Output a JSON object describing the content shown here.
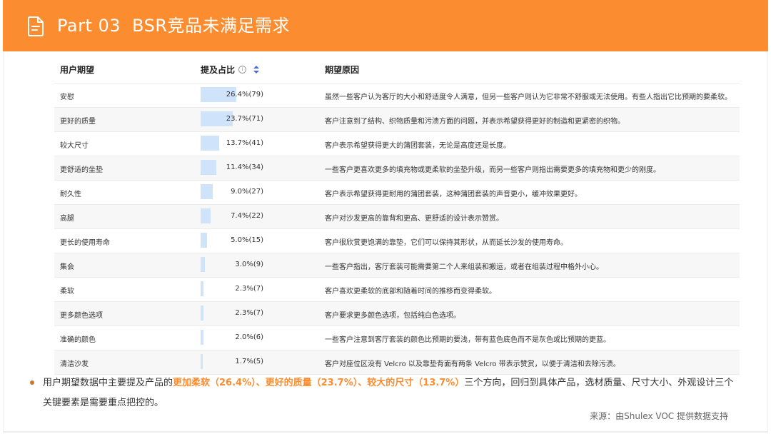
{
  "header": {
    "part": "Part 03",
    "title": "BSR竞品未满足需求",
    "background_color": "#fb8c2f",
    "icon": "document-icon"
  },
  "table": {
    "columns": {
      "need": "用户期望",
      "pct": "提及占比",
      "reason": "期望原因"
    },
    "rows": [
      {
        "need": "安慰",
        "pct_label": "26.4%(79)",
        "pct": 26.4,
        "reason": "虽然一些客户认为客厅的大小和舒适度令人满意，但另一些客户则认为它非常不舒服或无法使用。有些人指出它比预期的要柔软。"
      },
      {
        "need": "更好的质量",
        "pct_label": "23.7%(71)",
        "pct": 23.7,
        "reason": "客户注意到了结构、织物质量和污渍方面的问题，并表示希望获得更好的制造和更紧密的织物。"
      },
      {
        "need": "较大尺寸",
        "pct_label": "13.7%(41)",
        "pct": 13.7,
        "reason": "客户表示希望获得更大的蒲团套装，无论是高度还是长度。"
      },
      {
        "need": "更舒适的坐垫",
        "pct_label": "11.4%(34)",
        "pct": 11.4,
        "reason": "一些客户更喜欢更多的填充物或更柔软的坐垫升级，而另一些客户则指出需要更多的填充物和更少的刚度。"
      },
      {
        "need": "耐久性",
        "pct_label": "9.0%(27)",
        "pct": 9.0,
        "reason": "客户表示希望获得更耐用的蒲团套装，这种蒲团套装的声音更小，缓冲效果更好。"
      },
      {
        "need": "高腿",
        "pct_label": "7.4%(22)",
        "pct": 7.4,
        "reason": "客户对沙发更高的靠背和更高、更舒适的设计表示赞赏。"
      },
      {
        "need": "更长的使用寿命",
        "pct_label": "5.0%(15)",
        "pct": 5.0,
        "reason": "客户很欣赏更饱满的靠垫，它们可以保持其形状，从而延长沙发的使用寿命。"
      },
      {
        "need": "集会",
        "pct_label": "3.0%(9)",
        "pct": 3.0,
        "reason": "一些客户指出，客厅套装可能需要第二个人来组装和搬运，或者在组装过程中格外小心。"
      },
      {
        "need": "柔软",
        "pct_label": "2.3%(7)",
        "pct": 2.3,
        "reason": "客户喜欢更柔软的底部和随着时间的推移而变得柔软。"
      },
      {
        "need": "更多颜色选项",
        "pct_label": "2.3%(7)",
        "pct": 2.3,
        "reason": "客户要求更多颜色选项，包括纯白色选项。"
      },
      {
        "need": "准确的颜色",
        "pct_label": "2.0%(6)",
        "pct": 2.0,
        "reason": "一些客户注意到客厅套装的颜色比预期的要浅，带有蓝色底色而不是灰色或比预期的更蓝。"
      },
      {
        "need": "清洁沙发",
        "pct_label": "1.7%(5)",
        "pct": 1.7,
        "reason": "客户对座位区没有 Velcro 以及靠垫背面有两条 Velcro 带表示赞赏，以便于清洁和去除污渍。"
      }
    ],
    "bar_color": "#cfe4fb"
  },
  "summary": {
    "prefix": "用户期望数据中主要提及产品的",
    "highlight": "更加柔软（26.4%）、更好的质量（23.7%）、较大的尺寸（13.7%）",
    "suffix": "三个方向，回归到具体产品，选材质量、尺寸大小、外观设计三个关键要素是需要重点把控的。",
    "highlight_color": "#fb8c2f"
  },
  "source": "来源：由Shulex VOC 提供数据支持"
}
